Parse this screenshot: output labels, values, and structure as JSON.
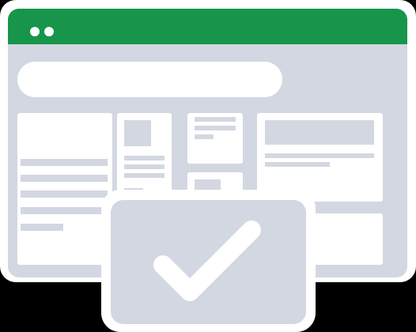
{
  "illustration": {
    "window": {
      "titlebar_color": "#17954b",
      "body_color": "#d3d7e1",
      "window_controls": [
        "dot",
        "dot"
      ]
    },
    "badge": {
      "icon": "checkmark-icon",
      "icon_color": "#ffffff",
      "background_color": "#d3d7e1"
    }
  }
}
